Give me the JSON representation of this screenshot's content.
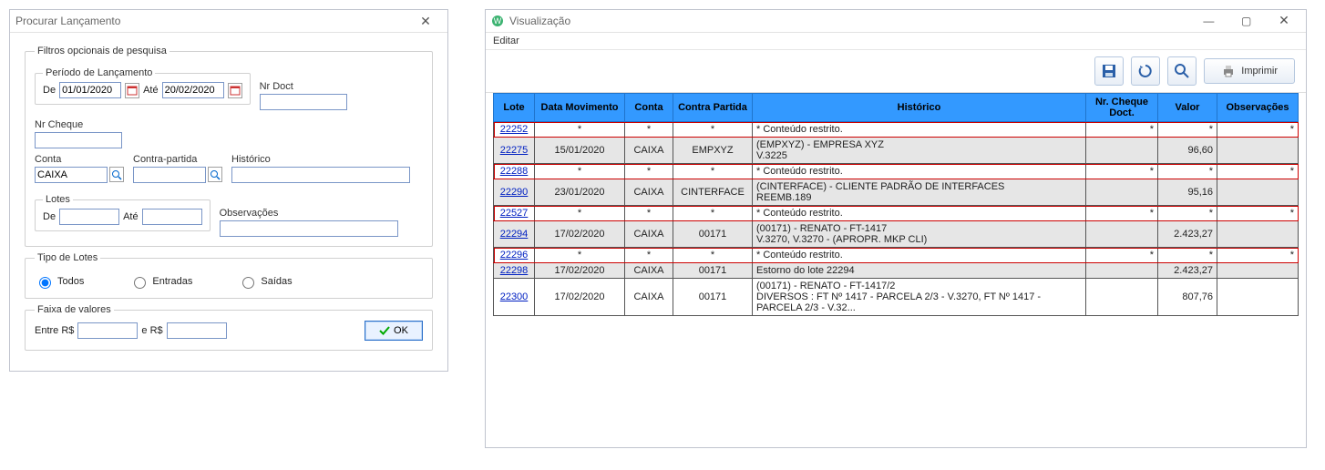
{
  "search_window": {
    "title": "Procurar Lançamento",
    "filters_legend": "Filtros opcionais de pesquisa",
    "period_legend": "Período de Lançamento",
    "de_label": "De",
    "de_value": "01/01/2020",
    "ate_label": "Até",
    "ate_value": "20/02/2020",
    "nrdoct_label": "Nr Doct",
    "nrdoct_value": "",
    "nrcheque_label": "Nr Cheque",
    "nrcheque_value": "",
    "conta_label": "Conta",
    "conta_value": "CAIXA",
    "contrapartida_label": "Contra-partida",
    "contrapartida_value": "",
    "historico_label": "Histórico",
    "historico_value": "",
    "lotes_legend": "Lotes",
    "lotes_de_label": "De",
    "lotes_de_value": "",
    "lotes_ate_label": "Até",
    "lotes_ate_value": "",
    "obs_label": "Observações",
    "obs_value": "",
    "tipo_legend": "Tipo de Lotes",
    "tipo_todos": "Todos",
    "tipo_entradas": "Entradas",
    "tipo_saidas": "Saídas",
    "faixa_legend": "Faixa de valores",
    "entre_label": "Entre R$",
    "entre_value": "",
    "ers_label": "e R$",
    "ers_value": "",
    "ok_label": "OK"
  },
  "vis_window": {
    "title": "Visualização",
    "menu_editar": "Editar",
    "print_label": "Imprimir",
    "columns": {
      "lote": "Lote",
      "data": "Data Movimento",
      "conta": "Conta",
      "contra": "Contra Partida",
      "hist": "Histórico",
      "cheque": "Nr. Cheque Doct.",
      "valor": "Valor",
      "obs": "Observações"
    },
    "rows": [
      {
        "lote": "22252",
        "data": "*",
        "conta": "*",
        "contra": "*",
        "hist": "* Conteúdo restrito.",
        "cheque": "*",
        "valor": "*",
        "obs": "*",
        "restricted": true,
        "alt": false
      },
      {
        "lote": "22275",
        "data": "15/01/2020",
        "conta": "CAIXA",
        "contra": "EMPXYZ",
        "hist": "(EMPXYZ) - EMPRESA XYZ\nV.3225",
        "cheque": "",
        "valor": "96,60",
        "obs": "",
        "restricted": false,
        "alt": true
      },
      {
        "lote": "22288",
        "data": "*",
        "conta": "*",
        "contra": "*",
        "hist": "* Conteúdo restrito.",
        "cheque": "*",
        "valor": "*",
        "obs": "*",
        "restricted": true,
        "alt": false
      },
      {
        "lote": "22290",
        "data": "23/01/2020",
        "conta": "CAIXA",
        "contra": "CINTERFACE",
        "hist": "(CINTERFACE) - CLIENTE PADRÃO DE INTERFACES\nREEMB.189",
        "cheque": "",
        "valor": "95,16",
        "obs": "",
        "restricted": false,
        "alt": true
      },
      {
        "lote": "22527",
        "data": "*",
        "conta": "*",
        "contra": "*",
        "hist": "* Conteúdo restrito.",
        "cheque": "*",
        "valor": "*",
        "obs": "*",
        "restricted": true,
        "alt": false
      },
      {
        "lote": "22294",
        "data": "17/02/2020",
        "conta": "CAIXA",
        "contra": "00171",
        "hist": "(00171) - RENATO - FT-1417\nV.3270, V.3270 - (APROPR. MKP CLI)",
        "cheque": "",
        "valor": "2.423,27",
        "obs": "",
        "restricted": false,
        "alt": true
      },
      {
        "lote": "22296",
        "data": "*",
        "conta": "*",
        "contra": "*",
        "hist": "* Conteúdo restrito.",
        "cheque": "*",
        "valor": "*",
        "obs": "*",
        "restricted": true,
        "alt": false
      },
      {
        "lote": "22298",
        "data": "17/02/2020",
        "conta": "CAIXA",
        "contra": "00171",
        "hist": "Estorno do lote 22294",
        "cheque": "",
        "valor": "2.423,27",
        "obs": "",
        "restricted": false,
        "alt": true
      },
      {
        "lote": "22300",
        "data": "17/02/2020",
        "conta": "CAIXA",
        "contra": "00171",
        "hist": "(00171) - RENATO - FT-1417/2\nDIVERSOS : FT Nº 1417 - PARCELA 2/3 - V.3270, FT Nº 1417 - PARCELA 2/3 - V.32...",
        "cheque": "",
        "valor": "807,76",
        "obs": "",
        "restricted": false,
        "alt": false
      }
    ]
  }
}
